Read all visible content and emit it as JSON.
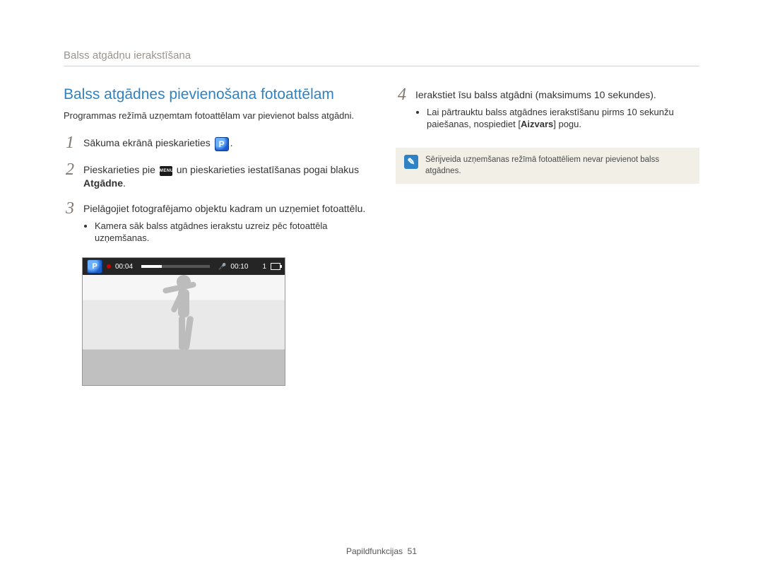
{
  "header": "Balss atgādņu ierakstīšana",
  "title": "Balss atgādnes pievienošana fotoattēlam",
  "intro": "Programmas režīmā uzņemtam fotoattēlam var pievienot balss atgādni.",
  "steps": {
    "s1": {
      "num": "1",
      "a": "Sākuma ekrānā pieskarieties ",
      "b": "."
    },
    "s2": {
      "num": "2",
      "a": "Pieskarieties pie ",
      "b": " un pieskarieties iestatīšanas pogai blakus ",
      "kw": "Atgādne",
      "c": "."
    },
    "s3": {
      "num": "3",
      "text": "Pielāgojiet fotografējamo objektu kadram un uzņemiet fotoattēlu.",
      "sub": "Kamera sāk balss atgādnes ierakstu uzreiz pēc fotoattēla uzņemšanas."
    },
    "s4": {
      "num": "4",
      "text": "Ierakstiet īsu balss atgādni (maksimums 10 sekundes).",
      "sub_a": "Lai pārtrauktu balss atgādnes ierakstīšanu pirms 10 sekunžu paiešanas, nospiediet [",
      "sub_kw": "Aizvars",
      "sub_b": "] pogu."
    }
  },
  "lcd": {
    "t1": "00:04",
    "t2": "00:10",
    "count": "1"
  },
  "note": "Sērijveida uzņemšanas režīmā fotoattēliem nevar pievienot balss atgādnes.",
  "footer": {
    "section": "Papildfunkcijas",
    "page": "51"
  }
}
